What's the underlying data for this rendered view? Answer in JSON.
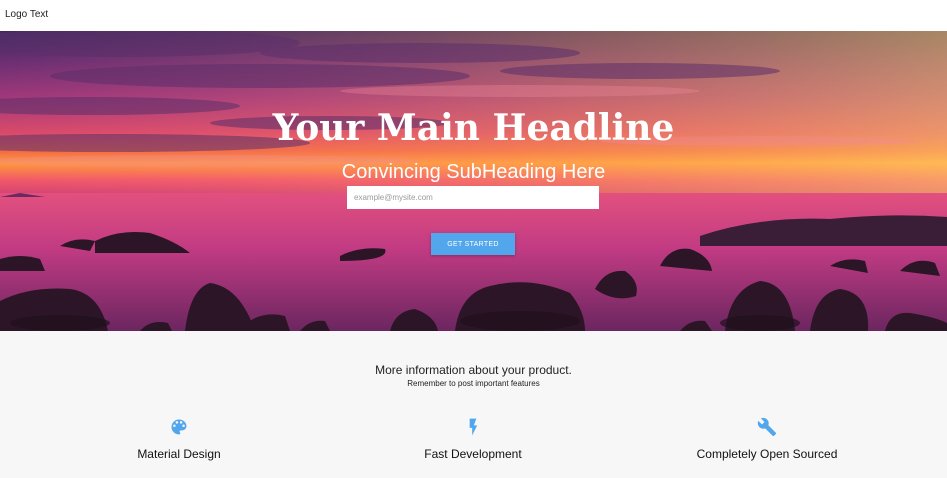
{
  "navbar": {
    "logo_text": "Logo Text"
  },
  "hero": {
    "headline": "Your Main Headline",
    "subheading": "Convincing SubHeading Here",
    "email_placeholder": "example@mysite.com",
    "cta_label": "GET STARTED"
  },
  "info": {
    "title": "More information about your product.",
    "subtitle": "Remember to post important features"
  },
  "features": [
    {
      "label": "Material Design",
      "icon": "palette-icon"
    },
    {
      "label": "Fast Development",
      "icon": "flash-icon"
    },
    {
      "label": "Completely Open Sourced",
      "icon": "wrench-icon"
    }
  ],
  "colors": {
    "accent": "#52a7ec",
    "navbar_bg": "#ffffff",
    "section_bg": "#f7f7f7"
  }
}
